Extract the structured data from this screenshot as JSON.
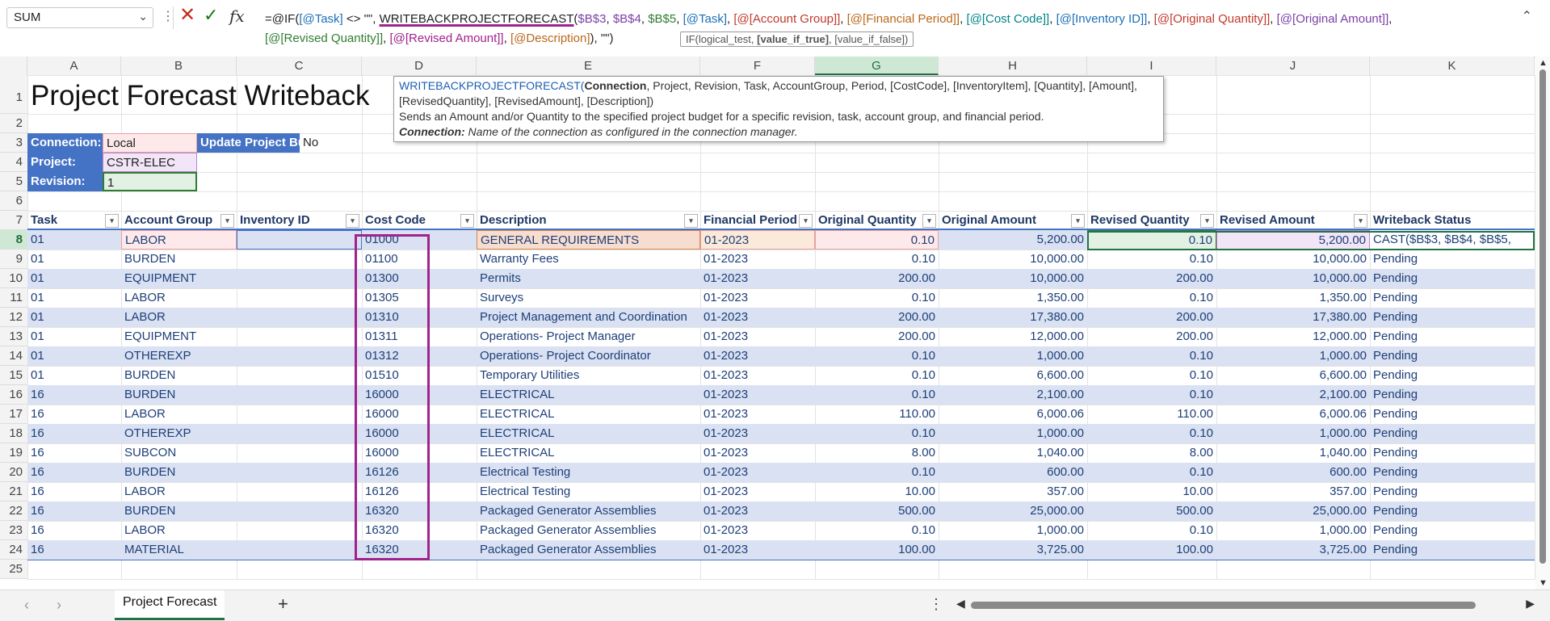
{
  "namebox": {
    "value": "SUM"
  },
  "formula_bar": {
    "icons": {
      "more": "vertical-dots-icon",
      "cancel": "x-icon",
      "enter": "check-icon",
      "fx": "fx-icon"
    },
    "segments": [
      {
        "t": "=@IF(",
        "c": ""
      },
      {
        "t": "[@Task]",
        "c": "c-blue"
      },
      {
        "t": " <> \"\", ",
        "c": ""
      },
      {
        "t": "WRITEBACKPROJECTFORECAST(",
        "c": "fn-ul"
      },
      {
        "t": "$B$3",
        "c": "c-pur"
      },
      {
        "t": ", ",
        "c": ""
      },
      {
        "t": "$B$4",
        "c": "c-pur"
      },
      {
        "t": ", ",
        "c": ""
      },
      {
        "t": "$B$5",
        "c": "c-grn"
      },
      {
        "t": ", ",
        "c": ""
      },
      {
        "t": "[@Task]",
        "c": "c-blue"
      },
      {
        "t": ", ",
        "c": ""
      },
      {
        "t": "[@[Account Group]]",
        "c": "c-red"
      },
      {
        "t": ", ",
        "c": ""
      },
      {
        "t": "[@[Financial Period]]",
        "c": "c-org"
      },
      {
        "t": ", ",
        "c": ""
      },
      {
        "t": "[@[Cost Code]]",
        "c": "c-teal"
      },
      {
        "t": ", ",
        "c": ""
      },
      {
        "t": "[@[Inventory ID]]",
        "c": "c-blue"
      },
      {
        "t": ", ",
        "c": ""
      },
      {
        "t": "[@[Original Quantity]]",
        "c": "c-red"
      },
      {
        "t": ", ",
        "c": ""
      },
      {
        "t": "[@[Original Amount]]",
        "c": "c-pur"
      },
      {
        "t": ",",
        "c": ""
      },
      {
        "br": true
      },
      {
        "t": "[@[Revised Quantity]]",
        "c": "c-grn"
      },
      {
        "t": ", ",
        "c": ""
      },
      {
        "t": "[@[Revised Amount]]",
        "c": "c-mag"
      },
      {
        "t": ", ",
        "c": ""
      },
      {
        "t": "[@Description]",
        "c": "c-org"
      },
      {
        "t": "), \"\")",
        "c": ""
      }
    ],
    "arg_tip": {
      "pre": "IF(logical_test, ",
      "bold": "[value_if_true]",
      "post": ", [value_if_false])"
    }
  },
  "columns": [
    "A",
    "B",
    "C",
    "D",
    "E",
    "F",
    "G",
    "H",
    "I",
    "J",
    "K"
  ],
  "selected_column": "G",
  "rows": [
    "1",
    "2",
    "3",
    "4",
    "5",
    "6",
    "7",
    "8",
    "9",
    "10",
    "11",
    "12",
    "13",
    "14",
    "15",
    "16",
    "17",
    "18",
    "19",
    "20",
    "21",
    "22",
    "23",
    "24",
    "25"
  ],
  "selected_row": "8",
  "sheet_title": "Project Forecast Writeback",
  "params": {
    "connection_label": "Connection:",
    "connection_value": "Local",
    "project_label": "Project:",
    "project_value": "CSTR-ELEC",
    "revision_label": "Revision:",
    "revision_value": "1",
    "update_label": "Update Project Budget",
    "update_value": "No"
  },
  "tooltip": {
    "fname": "WRITEBACKPROJECTFORECAST(",
    "first_arg": "Connection",
    "sig_rest": ", Project, Revision, Task, AccountGroup, Period, [CostCode], [InventoryItem], [Quantity], [Amount],",
    "sig_line2": "[RevisedQuantity], [RevisedAmount], [Description])",
    "desc": "Sends an Amount and/or Quantity to the specified project budget for a specific revision, task, account group, and financial period.",
    "arg_name": "Connection:",
    "arg_desc": " Name of the connection as configured in the connection manager."
  },
  "table": {
    "headers": [
      "Task",
      "Account Group",
      "Inventory ID",
      "Cost Code",
      "Description",
      "Financial Period",
      "Original Quantity",
      "Original Amount",
      "Revised Quantity",
      "Revised Amount",
      "Writeback Status"
    ],
    "rows": [
      [
        "01",
        "LABOR",
        "",
        "01000",
        "GENERAL REQUIREMENTS",
        "01-2023",
        "0.10",
        "5,200.00",
        "0.10",
        "5,200.00",
        "CAST($B$3, $B$4, $B$5,"
      ],
      [
        "01",
        "BURDEN",
        "",
        "01100",
        "Warranty Fees",
        "01-2023",
        "0.10",
        "10,000.00",
        "0.10",
        "10,000.00",
        "Pending"
      ],
      [
        "01",
        "EQUIPMENT",
        "",
        "01300",
        "Permits",
        "01-2023",
        "200.00",
        "10,000.00",
        "200.00",
        "10,000.00",
        "Pending"
      ],
      [
        "01",
        "LABOR",
        "",
        "01305",
        "Surveys",
        "01-2023",
        "0.10",
        "1,350.00",
        "0.10",
        "1,350.00",
        "Pending"
      ],
      [
        "01",
        "LABOR",
        "",
        "01310",
        "Project Management and Coordination",
        "01-2023",
        "200.00",
        "17,380.00",
        "200.00",
        "17,380.00",
        "Pending"
      ],
      [
        "01",
        "EQUIPMENT",
        "",
        "01311",
        "Operations- Project Manager",
        "01-2023",
        "200.00",
        "12,000.00",
        "200.00",
        "12,000.00",
        "Pending"
      ],
      [
        "01",
        "OTHEREXP",
        "",
        "01312",
        "Operations- Project Coordinator",
        "01-2023",
        "0.10",
        "1,000.00",
        "0.10",
        "1,000.00",
        "Pending"
      ],
      [
        "01",
        "BURDEN",
        "",
        "01510",
        "Temporary Utilities",
        "01-2023",
        "0.10",
        "6,600.00",
        "0.10",
        "6,600.00",
        "Pending"
      ],
      [
        "16",
        "BURDEN",
        "",
        "16000",
        "ELECTRICAL",
        "01-2023",
        "0.10",
        "2,100.00",
        "0.10",
        "2,100.00",
        "Pending"
      ],
      [
        "16",
        "LABOR",
        "",
        "16000",
        "ELECTRICAL",
        "01-2023",
        "110.00",
        "6,000.06",
        "110.00",
        "6,000.06",
        "Pending"
      ],
      [
        "16",
        "OTHEREXP",
        "",
        "16000",
        "ELECTRICAL",
        "01-2023",
        "0.10",
        "1,000.00",
        "0.10",
        "1,000.00",
        "Pending"
      ],
      [
        "16",
        "SUBCON",
        "",
        "16000",
        "ELECTRICAL",
        "01-2023",
        "8.00",
        "1,040.00",
        "8.00",
        "1,040.00",
        "Pending"
      ],
      [
        "16",
        "BURDEN",
        "",
        "16126",
        "Electrical Testing",
        "01-2023",
        "0.10",
        "600.00",
        "0.10",
        "600.00",
        "Pending"
      ],
      [
        "16",
        "LABOR",
        "",
        "16126",
        "Electrical Testing",
        "01-2023",
        "10.00",
        "357.00",
        "10.00",
        "357.00",
        "Pending"
      ],
      [
        "16",
        "BURDEN",
        "",
        "16320",
        "Packaged Generator Assemblies",
        "01-2023",
        "500.00",
        "25,000.00",
        "500.00",
        "25,000.00",
        "Pending"
      ],
      [
        "16",
        "LABOR",
        "",
        "16320",
        "Packaged Generator Assemblies",
        "01-2023",
        "0.10",
        "1,000.00",
        "0.10",
        "1,000.00",
        "Pending"
      ],
      [
        "16",
        "MATERIAL",
        "",
        "16320",
        "Packaged Generator Assemblies",
        "01-2023",
        "100.00",
        "3,725.00",
        "100.00",
        "3,725.00",
        "Pending"
      ]
    ]
  },
  "sheet_tabs": {
    "active": "Project Forecast",
    "add_icon": "plus-icon"
  },
  "colors": {
    "label_bg": "#4472c4",
    "band": "#d9e1f2",
    "highlight": "#a0228b",
    "selected": "#217346"
  }
}
